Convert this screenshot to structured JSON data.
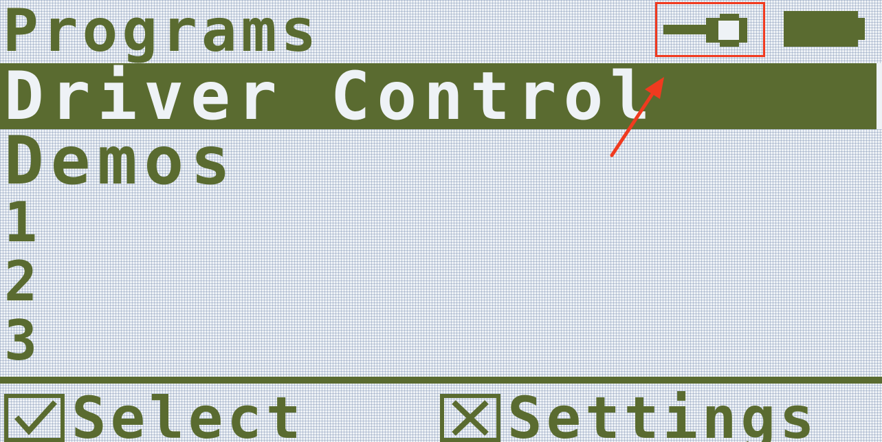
{
  "header": {
    "title": "Programs",
    "icons": [
      "controller-link-icon",
      "battery-icon"
    ]
  },
  "menu": {
    "selected_item": "Driver Control",
    "items": [
      "Demos",
      "1",
      "2",
      "3"
    ]
  },
  "softkeys": {
    "left": {
      "icon": "check-icon",
      "label": "Select"
    },
    "right": {
      "icon": "x-icon",
      "label": "Settings"
    }
  },
  "colors": {
    "lcd_dark": "#5a6b30",
    "lcd_light": "#eef2f6",
    "annotation": "#f03a1f"
  }
}
